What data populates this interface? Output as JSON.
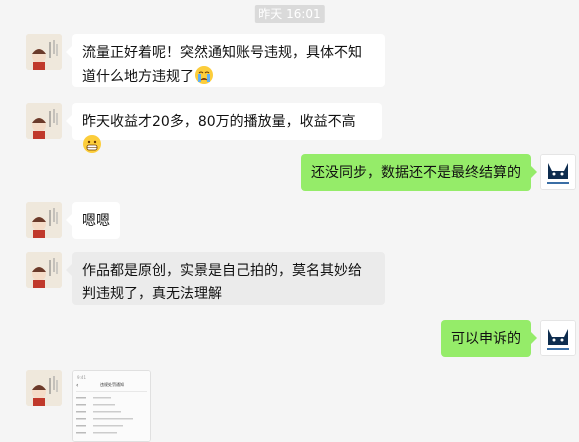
{
  "timestamp": "昨天 16:01",
  "messages": [
    {
      "side": "left",
      "text": "流量正好着呢！突然通知账号违规，具体不知道什么地方违规了",
      "emoji": "crying-face"
    },
    {
      "side": "left",
      "text": "昨天收益才20多，80万的播放量，收益不高",
      "emoji": "grimacing-face"
    },
    {
      "side": "right",
      "text": "还没同步，数据还不是最终结算的"
    },
    {
      "side": "left",
      "text": "嗯嗯"
    },
    {
      "side": "left",
      "text": "作品都是原创，实景是自己拍的，莫名其妙给判违规了，真无法理解"
    },
    {
      "side": "right",
      "text": "可以申诉的"
    },
    {
      "side": "left",
      "type": "image",
      "icon": "screenshot-thumbnail",
      "caption": "违规处罚通知"
    }
  ],
  "colors": {
    "background": "#f5f5f5",
    "bubble_left": "#ffffff",
    "bubble_right": "#95ec69",
    "timestamp_bg": "#dadada"
  }
}
